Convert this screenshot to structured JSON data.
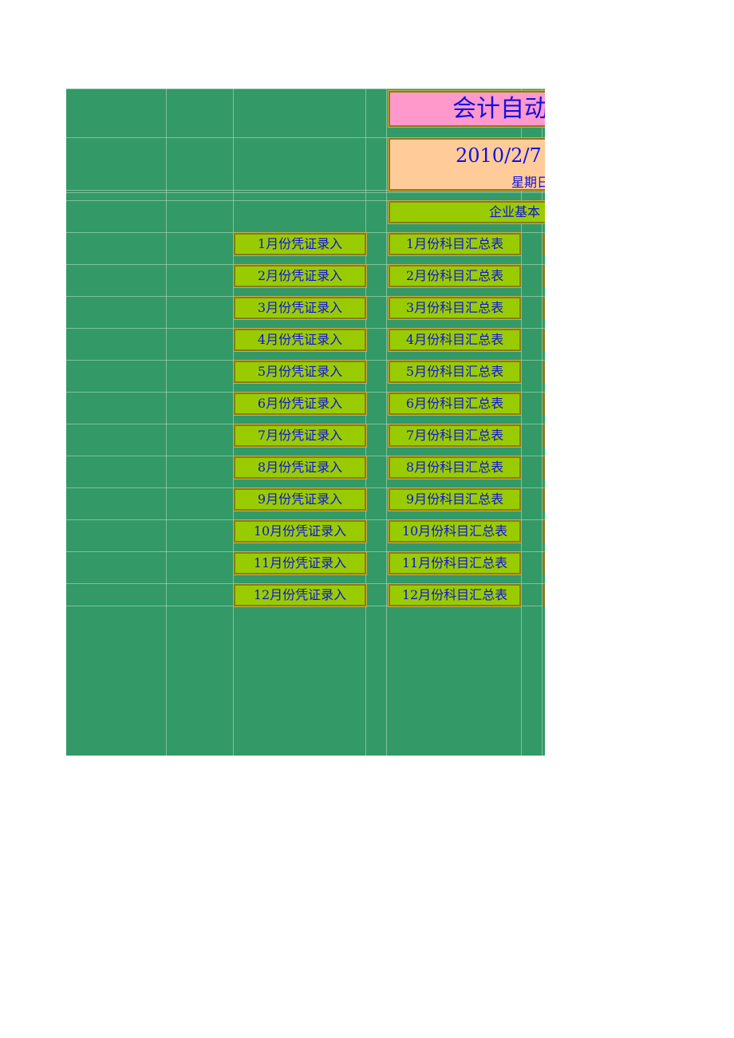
{
  "title": "会计自动",
  "date_panel": {
    "date": "2010/2/7",
    "weekday": "星期日"
  },
  "company_info_button": "企业基本",
  "voucher_entry_buttons": [
    "1月份凭证录入",
    "2月份凭证录入",
    "3月份凭证录入",
    "4月份凭证录入",
    "5月份凭证录入",
    "6月份凭证录入",
    "7月份凭证录入",
    "8月份凭证录入",
    "9月份凭证录入",
    "10月份凭证录入",
    "11月份凭证录入",
    "12月份凭证录入"
  ],
  "account_summary_buttons": [
    "1月份科目汇总表",
    "2月份科目汇总表",
    "3月份科目汇总表",
    "4月份科目汇总表",
    "5月份科目汇总表",
    "6月份科目汇总表",
    "7月份科目汇总表",
    "8月份科目汇总表",
    "9月份科目汇总表",
    "10月份科目汇总表",
    "11月份科目汇总表",
    "12月份科目汇总表"
  ],
  "colors": {
    "sheet_background": "#339966",
    "title_fill": "#ff99cc",
    "date_fill": "#ffcc99",
    "button_fill": "#99cc00",
    "text": "#1010e0"
  }
}
